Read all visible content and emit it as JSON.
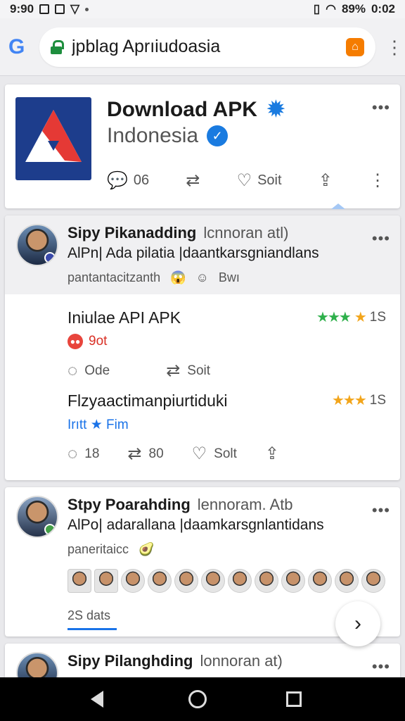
{
  "status": {
    "time": "9:90",
    "battery": "89%",
    "clock": "0:02"
  },
  "browser": {
    "url": "jpblag Aprıiudoasia"
  },
  "app": {
    "title": "Download APK",
    "subtitle": "Indonesia",
    "comments": "06",
    "likes": "Soit"
  },
  "post1": {
    "name": "Sipy Pikanadding",
    "handle": "lcnnoran atl)",
    "text": "AlPn| Ada pilatia  |daantkarsgniandlans",
    "meta": "pantantacitzanth",
    "meta2": "Bwı"
  },
  "item1": {
    "title": "Iniulae API APK",
    "count": "1S",
    "tag": "9ot",
    "comment": "Ode",
    "share": "Soit"
  },
  "item2": {
    "title": "Flzyaactimanpiurtiduki",
    "count": "1S",
    "tag": "Irıtt ★ Fim",
    "comments": "18",
    "retweets": "80",
    "likes": "Solt"
  },
  "post2": {
    "name": "Stpy Poarahding",
    "handle": "lennoram. Atb",
    "text": "AlPo| adarallana  |daamkarsgnlantidans",
    "meta": "paneritaicc",
    "count": "2S dats"
  },
  "post3": {
    "name": "Sipy Pilanghding",
    "handle": "lonnoran at)"
  }
}
